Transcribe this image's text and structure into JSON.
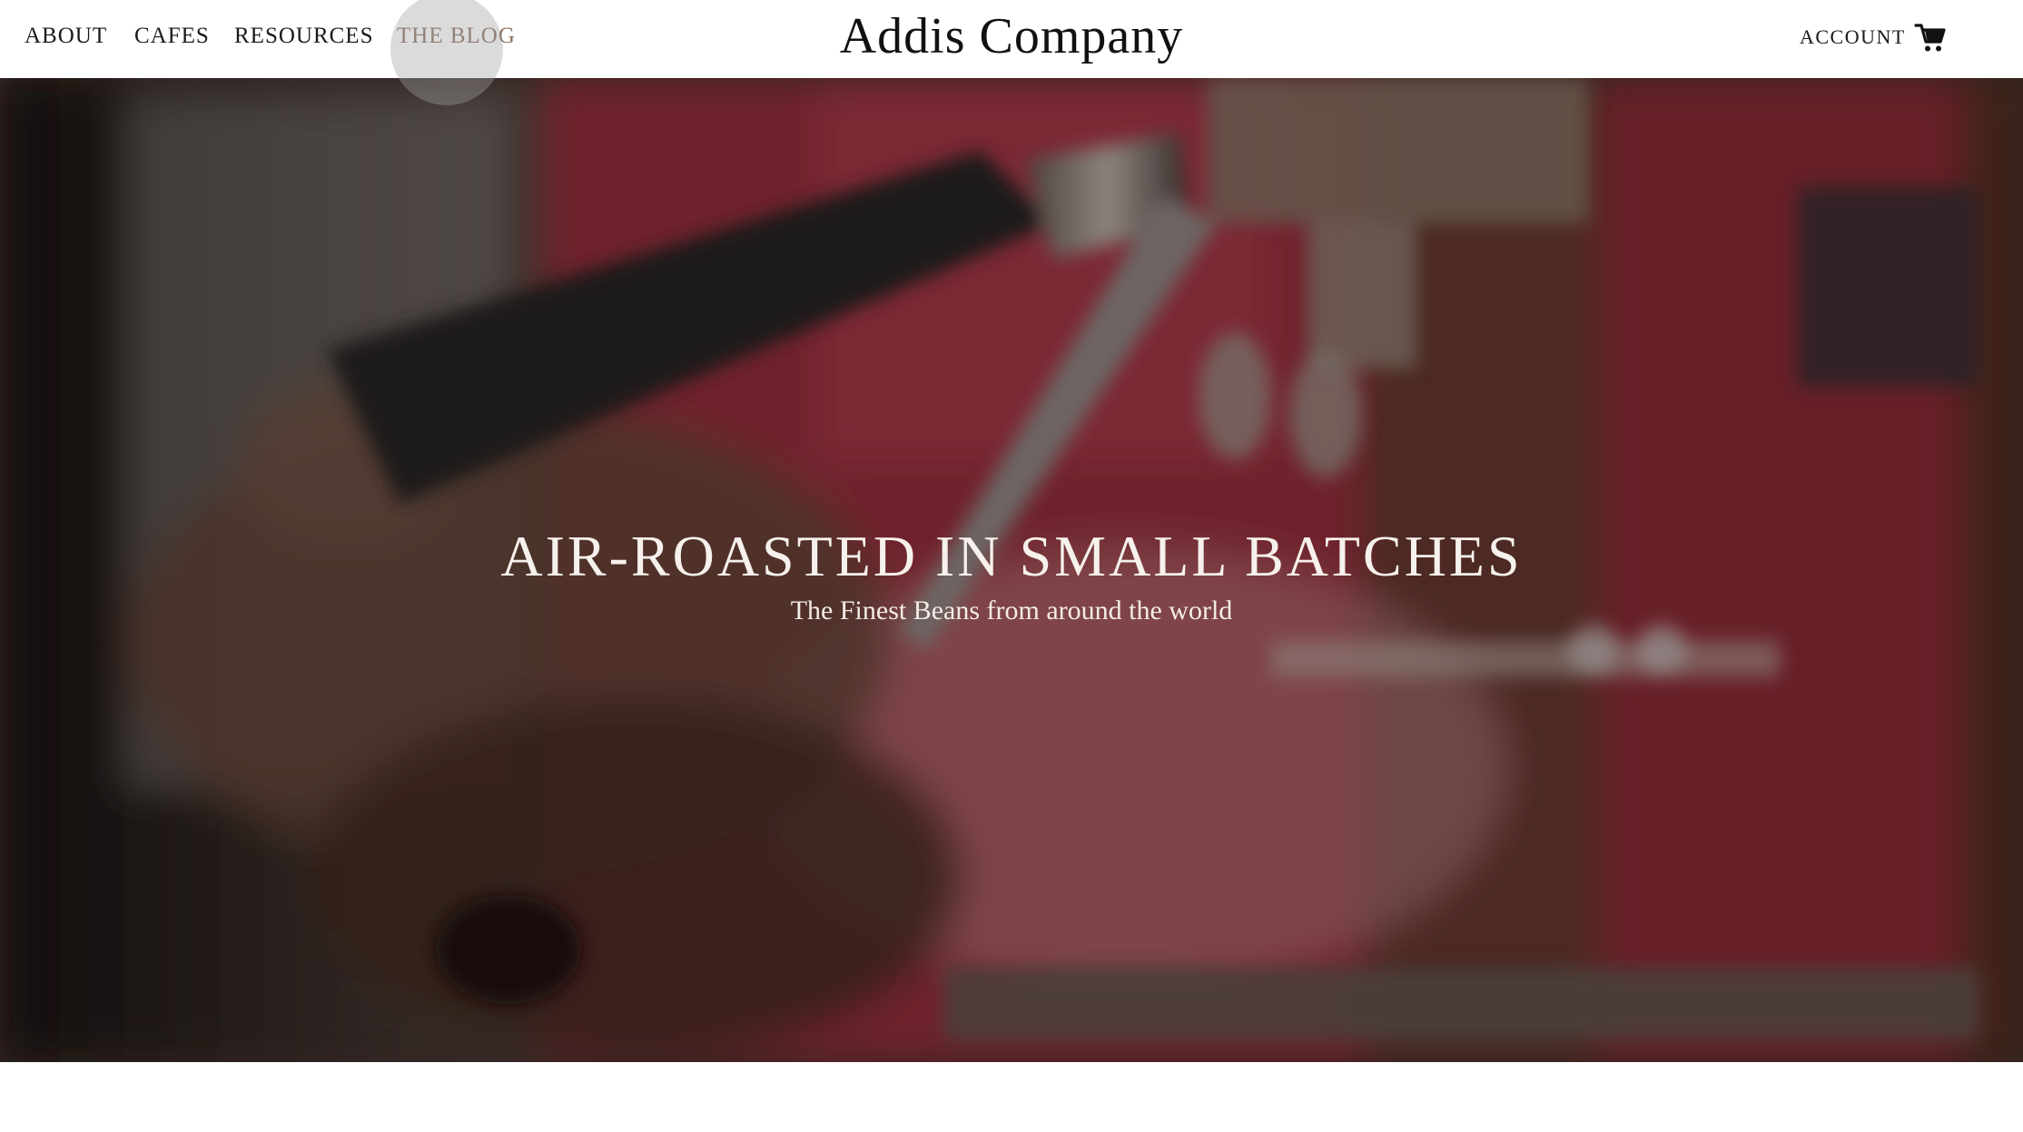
{
  "header": {
    "nav": [
      {
        "label": "ABOUT"
      },
      {
        "label": "CAFES"
      },
      {
        "label": "RESOURCES"
      },
      {
        "label": "THE BLOG"
      }
    ],
    "brand": "Addis Company",
    "account_label": "ACCOUNT",
    "cart_icon": "shopping-cart-icon"
  },
  "hero": {
    "title": "AIR-ROASTED IN SMALL BATCHES",
    "subtitle": "The Finest Beans from around the world"
  },
  "colors": {
    "active_nav": "#8a6f5e",
    "text_dark": "#1a1a1a",
    "hero_text": "#f6f1ec"
  }
}
